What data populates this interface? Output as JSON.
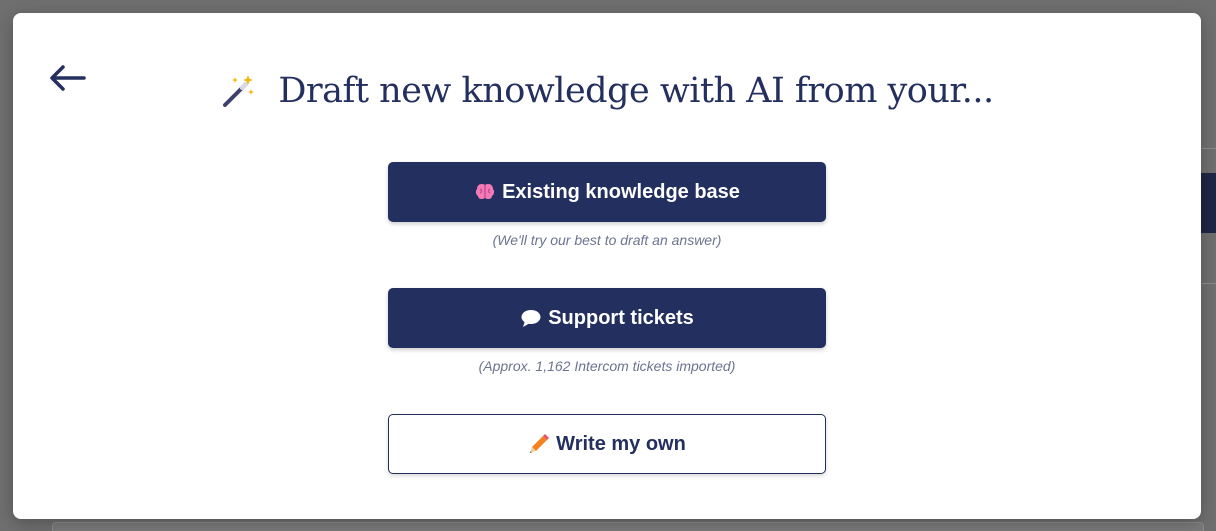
{
  "modal": {
    "title": "Draft new knowledge with AI from your...",
    "back_icon": "arrow-left-icon",
    "title_icon": "magic-wand-icon"
  },
  "options": [
    {
      "label": "Existing knowledge base",
      "icon": "brain-icon",
      "hint": "(We'll try our best to draft an answer)"
    },
    {
      "label": "Support tickets",
      "icon": "speech-bubble-icon",
      "hint": "(Approx. 1,162 Intercom tickets imported)"
    },
    {
      "label": "Write my own",
      "icon": "pencil-icon"
    }
  ],
  "colors": {
    "primary": "#232f5e",
    "hint": "#6b7390",
    "overlay": "#6f6f6f"
  }
}
